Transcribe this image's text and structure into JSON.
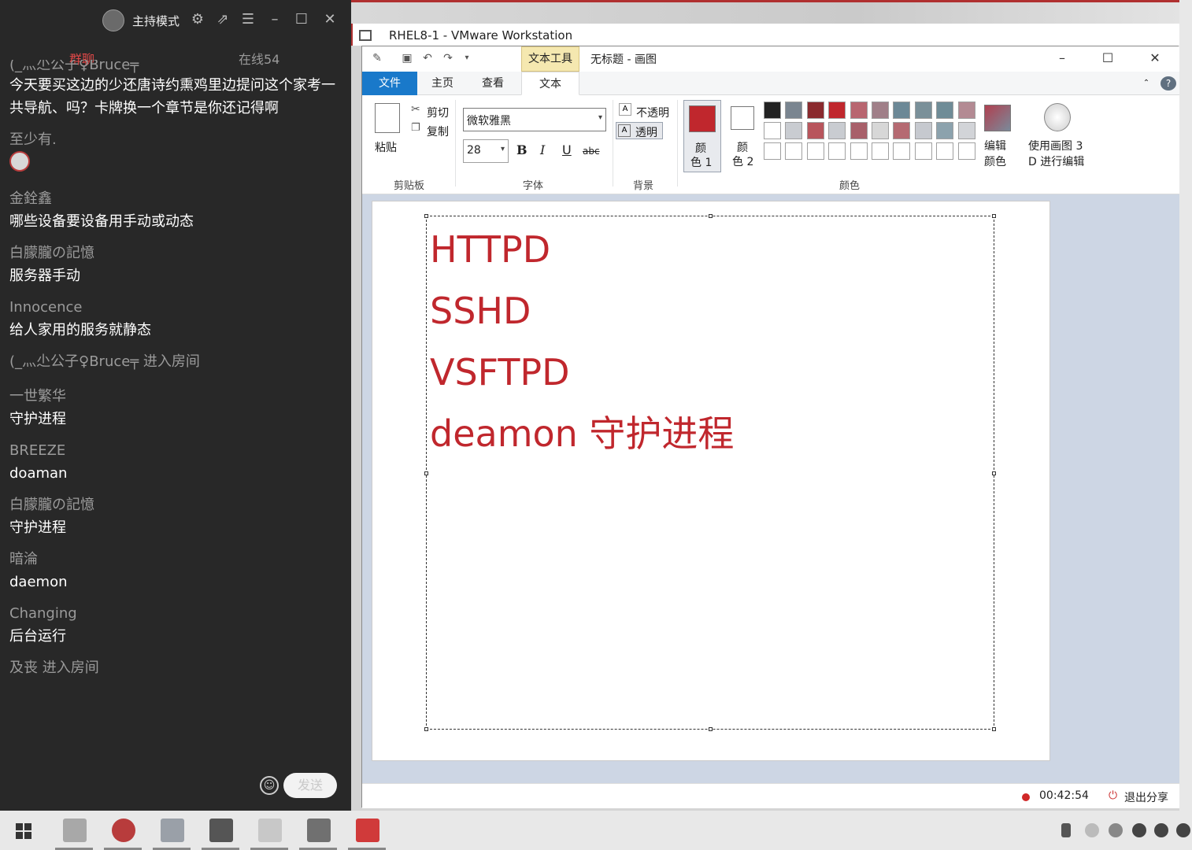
{
  "chat": {
    "host_label": "主持模式",
    "tabs": {
      "group": "群聊",
      "online": "在线54"
    },
    "messages": [
      {
        "user": "(_灬尐公子♀Bruce╤",
        "text": "今天要买这边的少还唐诗约熏鸡里边提问这个家考一共导航、吗？卡牌换一个章节是你还记得啊"
      },
      {
        "user": "至少有.",
        "text": ""
      },
      {
        "user": "金銓鑫",
        "text": "哪些设备要设备用手动或动态"
      },
      {
        "user": "白朦朧の記憶",
        "text": "服务器手动"
      },
      {
        "user": "Innocence",
        "text": "给人家用的服务就静态"
      }
    ],
    "system1": "(_灬尐公子♀Bruce╤  进入房间",
    "messages2": [
      {
        "user": "一世繁华",
        "text": "守护进程"
      },
      {
        "user": "BREEZE",
        "text": "doaman"
      },
      {
        "user": "白朦朧の記憶",
        "text": "守护进程"
      },
      {
        "user": "暗淪",
        "text": "daemon"
      },
      {
        "user": "Changing",
        "text": "后台运行"
      }
    ],
    "system2": "及丧 进入房间",
    "send_label": "发送"
  },
  "vmware": {
    "title": "RHEL8-1 - VMware Workstation"
  },
  "paint": {
    "context_tab": "文本工具",
    "title": "无标题 - 画图",
    "tabs": [
      "文件",
      "主页",
      "查看",
      "文本"
    ],
    "clipboard": {
      "paste": "粘贴",
      "cut": "剪切",
      "copy": "复制",
      "group": "剪贴板"
    },
    "font": {
      "family": "微软雅黑",
      "size": "28",
      "group": "字体"
    },
    "background": {
      "opaque": "不透明",
      "transparent": "透明",
      "group": "背景"
    },
    "colors": {
      "color1": "颜\n色 1",
      "color2": "颜\n色 2",
      "color1_label_a": "颜",
      "color1_label_b": "色 1",
      "color2_label_a": "颜",
      "color2_label_b": "色 2",
      "edit_a": "编辑",
      "edit_b": "颜色",
      "p3d_a": "使用画图 3",
      "p3d_b": "D 进行编辑",
      "group": "颜色",
      "color1_hex": "#c0272d",
      "palette_row1": [
        "#222222",
        "#7a8590",
        "#8a2a2e",
        "#c0272d",
        "#b86670",
        "#a07f88",
        "#6c8896",
        "#7a9099",
        "#6f8c97",
        "#b38a93"
      ],
      "palette_row2": [
        "#ffffff",
        "#c9ccd1",
        "#b8555c",
        "#c9ccd1",
        "#a8606a",
        "#d7d7d7",
        "#b56a72",
        "#c6c9cf",
        "#8ca2ad",
        "#d2d4d8"
      ],
      "palette_row3": [
        "#ffffff",
        "#ffffff",
        "#ffffff",
        "#ffffff",
        "#ffffff",
        "#ffffff",
        "#ffffff",
        "#ffffff",
        "#ffffff",
        "#ffffff"
      ]
    },
    "text_lines": [
      "HTTPD",
      "SSHD",
      "VSFTPD",
      "deamon 守护进程"
    ],
    "status": {
      "timer": "00:42:54",
      "exit_share": "退出分享"
    }
  }
}
